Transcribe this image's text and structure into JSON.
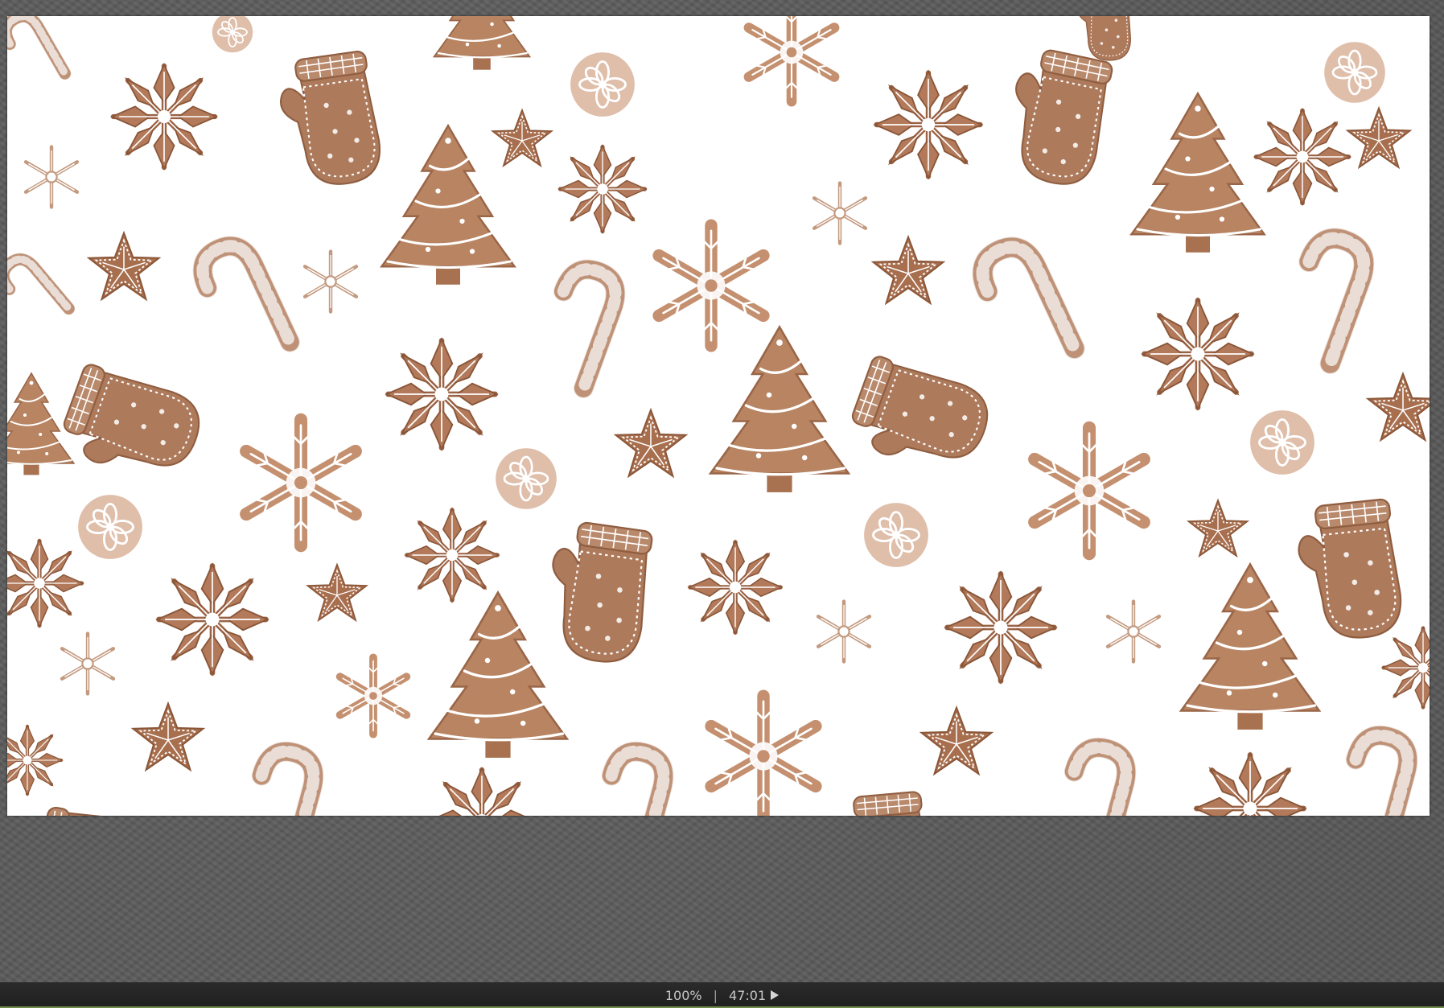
{
  "canvas": {
    "artwork": "gingerbread-cookie-pattern",
    "cookie_color": "#b98a6e",
    "icing_color": "#ffffff"
  },
  "statusbar": {
    "zoom": "100%",
    "separator": "|",
    "timecode": "47:01",
    "play_icon": "play-icon"
  }
}
